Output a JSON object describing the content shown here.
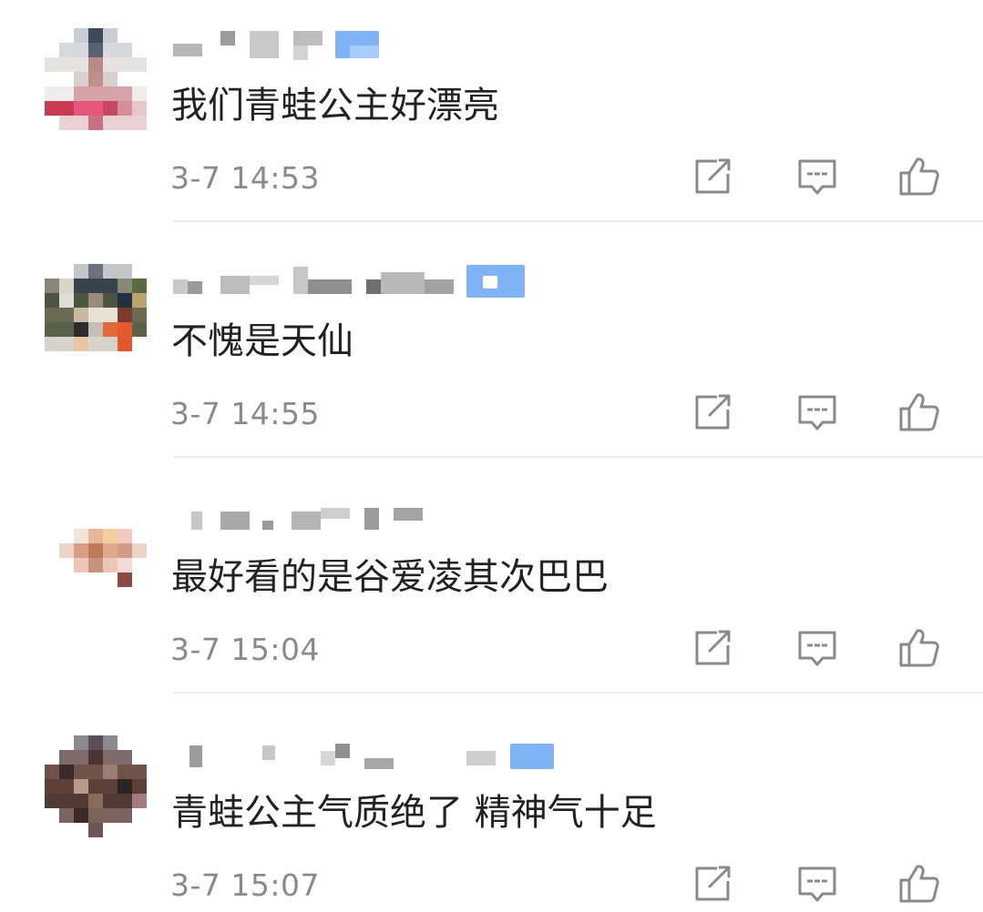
{
  "comments": [
    {
      "text": "我们青蛙公主好漂亮",
      "time": "3-7 14:53"
    },
    {
      "text": "不愧是天仙",
      "time": "3-7 14:55"
    },
    {
      "text": "最好看的是谷爱凌其次巴巴",
      "time": "3-7 15:04"
    },
    {
      "text": "青蛙公主气质绝了 精神气十足",
      "time": "3-7 15:07"
    }
  ],
  "icons": {
    "share": "share-icon",
    "reply": "comment-reply-icon",
    "like": "thumbs-up-icon"
  },
  "colors": {
    "text": "#222222",
    "timestamp": "#8a8a8a",
    "icon": "#8a8a8a",
    "divider": "#ececec",
    "badge": "#7fb3f5"
  }
}
